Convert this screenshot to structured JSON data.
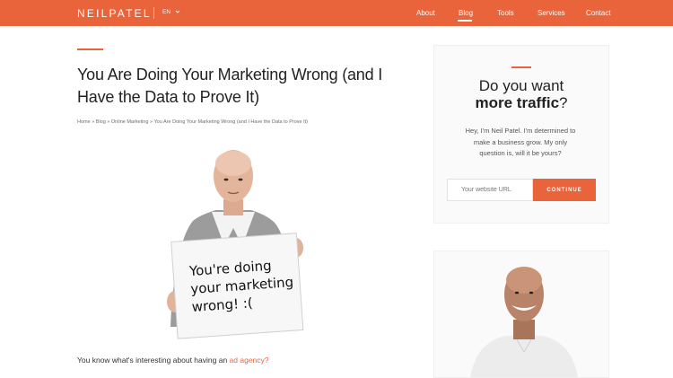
{
  "header": {
    "logo": "NEILPATEL",
    "lang": "EN",
    "nav": [
      "About",
      "Blog",
      "Tools",
      "Services",
      "Contact"
    ],
    "active_nav": "Blog",
    "bg_color": "#e9643b"
  },
  "article": {
    "title": "You Are Doing Your Marketing Wrong (and I Have the Data to Prove It)",
    "breadcrumb": "Home » Blog » Online Marketing » You Are Doing Your Marketing Wrong (and I Have the Data to Prove It)",
    "sign_text": [
      "You're doing",
      "your marketing",
      "wrong! :("
    ],
    "intro_prefix": "You know what's interesting about having an ",
    "intro_link": "ad agency?"
  },
  "signup": {
    "heading_line1": "Do you want",
    "heading_bold": "more traffic",
    "heading_end": "?",
    "text": "Hey, I'm Neil Patel. I'm determined to make a business grow. My only question is, will it be yours?",
    "input_placeholder": "Your website URL",
    "cta_label": "CONTINUE"
  },
  "accent_color": "#e9643b",
  "icons": [
    "chevron-down-icon"
  ]
}
